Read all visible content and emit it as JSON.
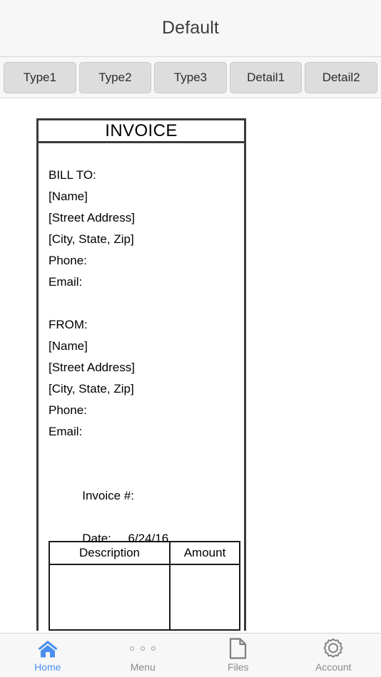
{
  "navbar": {
    "title": "Default"
  },
  "tabstrip": {
    "buttons": [
      {
        "label": "Type1",
        "name": "tab-type1"
      },
      {
        "label": "Type2",
        "name": "tab-type2"
      },
      {
        "label": "Type3",
        "name": "tab-type3"
      },
      {
        "label": "Detail1",
        "name": "tab-detail1"
      },
      {
        "label": "Detail2",
        "name": "tab-detail2"
      }
    ]
  },
  "invoice": {
    "heading": "INVOICE",
    "bill_to": {
      "label": "BILL TO:",
      "name": "[Name]",
      "street": "[Street Address]",
      "city_state_zip": "[City, State, Zip]",
      "phone": "Phone:",
      "email": "Email:"
    },
    "from": {
      "label": "FROM:",
      "name": "[Name]",
      "street": "[Street Address]",
      "city_state_zip": "[City, State, Zip]",
      "phone": "Phone:",
      "email": "Email:"
    },
    "invoice_number_label": "Invoice #:",
    "invoice_number_value": "",
    "date_label": "Date:",
    "date_value": "6/24/16",
    "table": {
      "headers": [
        "Description",
        "Amount"
      ],
      "rows": [
        {
          "description": "",
          "amount": ""
        }
      ]
    }
  },
  "tabbar": {
    "items": [
      {
        "label": "Home",
        "icon": "home-icon",
        "active": true
      },
      {
        "label": "Menu",
        "icon": "dots-icon",
        "active": false
      },
      {
        "label": "Files",
        "icon": "file-icon",
        "active": false
      },
      {
        "label": "Account",
        "icon": "gear-icon",
        "active": false
      }
    ]
  },
  "colors": {
    "accent": "#4a8ef0",
    "inactive": "#8a8a8a",
    "chrome_bg": "#f7f7f7",
    "tab_button_bg": "#dddddd",
    "ink": "#000000"
  }
}
